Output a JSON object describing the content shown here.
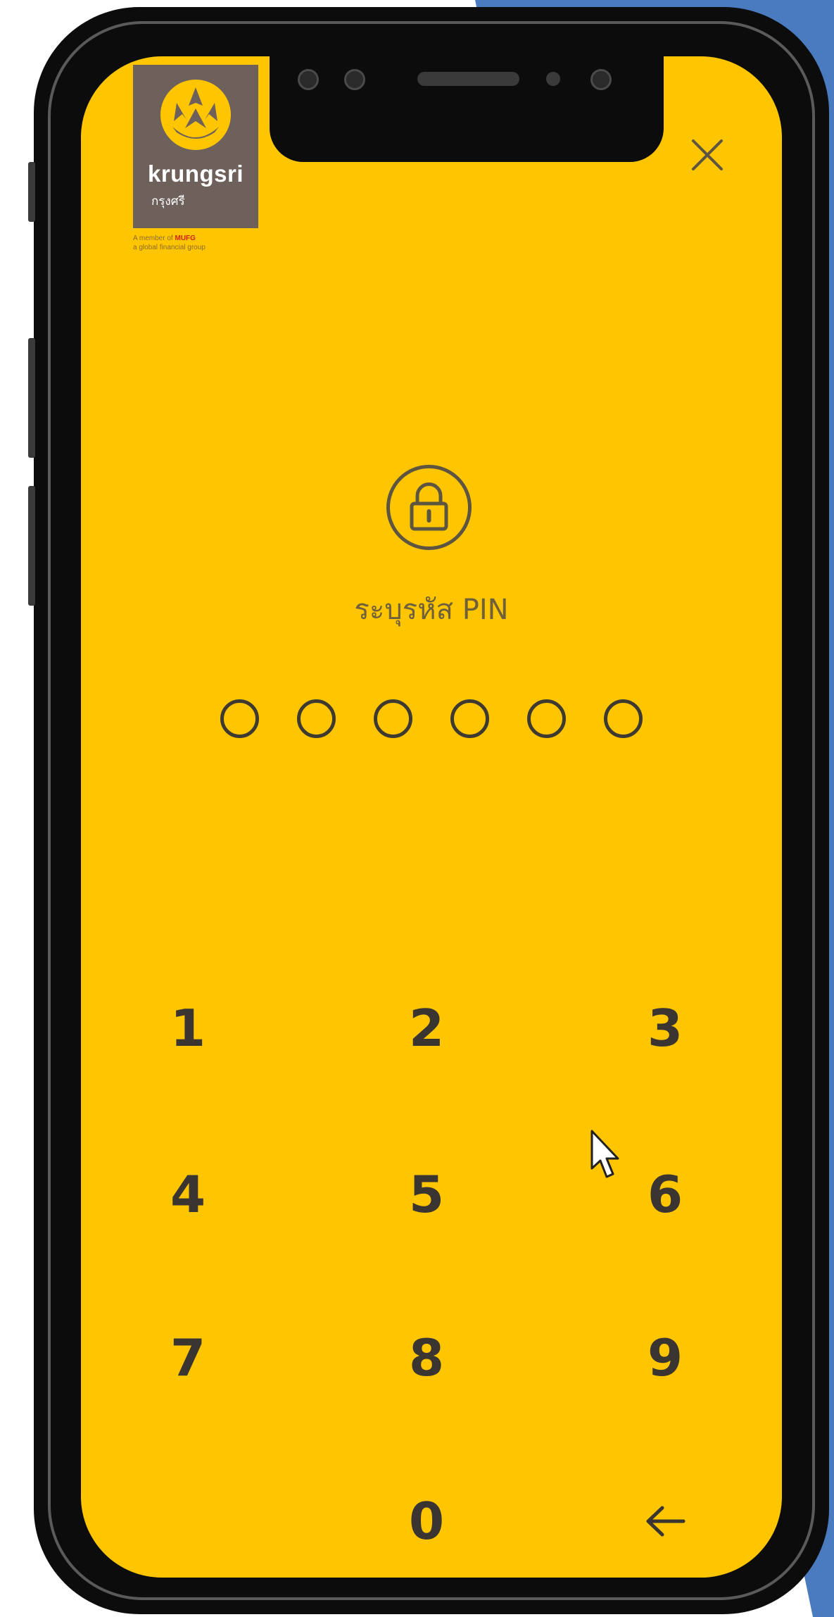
{
  "brand": {
    "name": "krungsri",
    "thai_name": "กรุงศรี",
    "tagline_line1_prefix": "A member of",
    "tagline_mufg": "MUFG",
    "tagline_line2": "a global financial group",
    "screen_color": "#ffc600",
    "logo_bg_color": "#6e605a"
  },
  "header": {
    "close_icon": "close-icon"
  },
  "pin": {
    "lock_icon": "lock-icon",
    "label": "ระบุรหัส PIN",
    "length": 6,
    "filled": 0
  },
  "keypad": {
    "keys": [
      "1",
      "2",
      "3",
      "4",
      "5",
      "6",
      "7",
      "8",
      "9",
      "0"
    ],
    "backspace_icon": "backspace-arrow-icon"
  }
}
